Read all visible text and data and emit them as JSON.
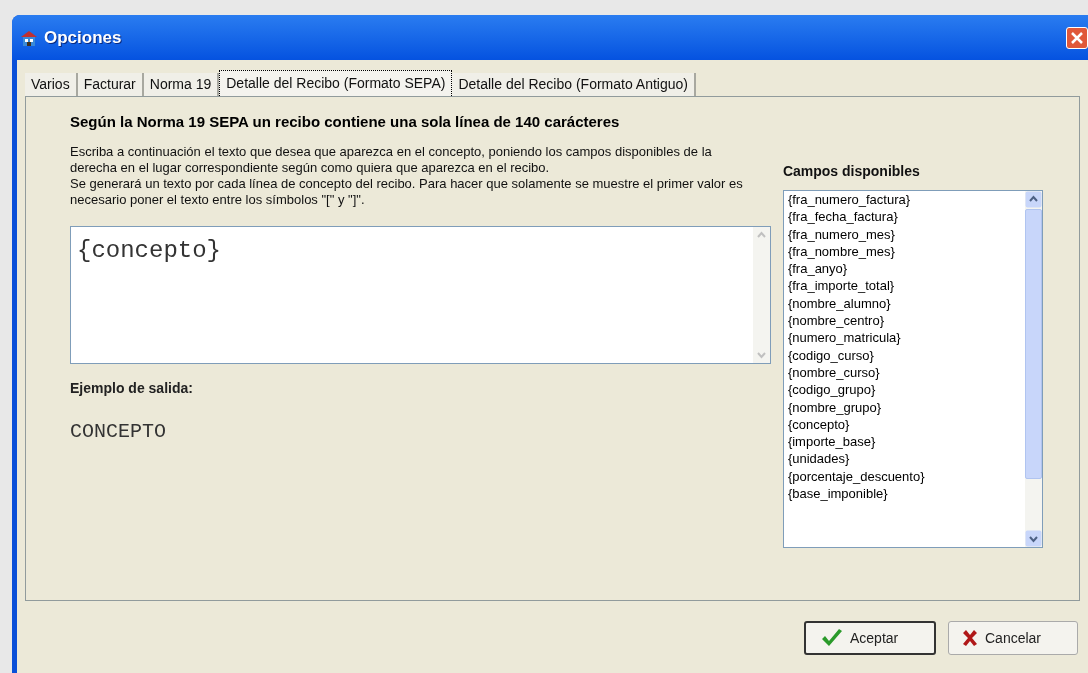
{
  "window": {
    "title": "Opciones"
  },
  "tabs": [
    {
      "label": "Varios",
      "selected": false
    },
    {
      "label": "Facturar",
      "selected": false
    },
    {
      "label": "Norma 19",
      "selected": false
    },
    {
      "label": "Detalle del Recibo (Formato SEPA)",
      "selected": true
    },
    {
      "label": "Detalle del Recibo (Formato Antiguo)",
      "selected": false
    }
  ],
  "heading": "Según la Norma 19 SEPA un recibo contiene una sola línea de 140 carácteres",
  "instructions": [
    "Escriba a continuación el texto que desea que aparezca en el concepto, poniendo los campos disponibles de la derecha en el lugar correspondiente según como quiera que aparezca en el recibo.",
    "Se generará un texto por cada línea de concepto del recibo. Para hacer que solamente se muestre el primer valor es necesario poner el texto entre los símbolos \"[\" y \"]\"."
  ],
  "concept_field": {
    "value": "{concepto}"
  },
  "example": {
    "label": "Ejemplo de salida:",
    "output": "CONCEPTO"
  },
  "fields_list": {
    "title": "Campos disponibles",
    "items": [
      "{fra_numero_factura}",
      "{fra_fecha_factura}",
      "{fra_numero_mes}",
      "{fra_nombre_mes}",
      "{fra_anyo}",
      "{fra_importe_total}",
      "{nombre_alumno}",
      "{nombre_centro}",
      "{numero_matricula}",
      "{codigo_curso}",
      "{nombre_curso}",
      "{codigo_grupo}",
      "{nombre_grupo}",
      "{concepto}",
      "{importe_base}",
      "{unidades}",
      "{porcentaje_descuento}",
      "{base_imponible}"
    ]
  },
  "buttons": [
    {
      "kind": "ok",
      "label": "Aceptar"
    },
    {
      "kind": "cancel",
      "label": "Cancelar"
    }
  ]
}
